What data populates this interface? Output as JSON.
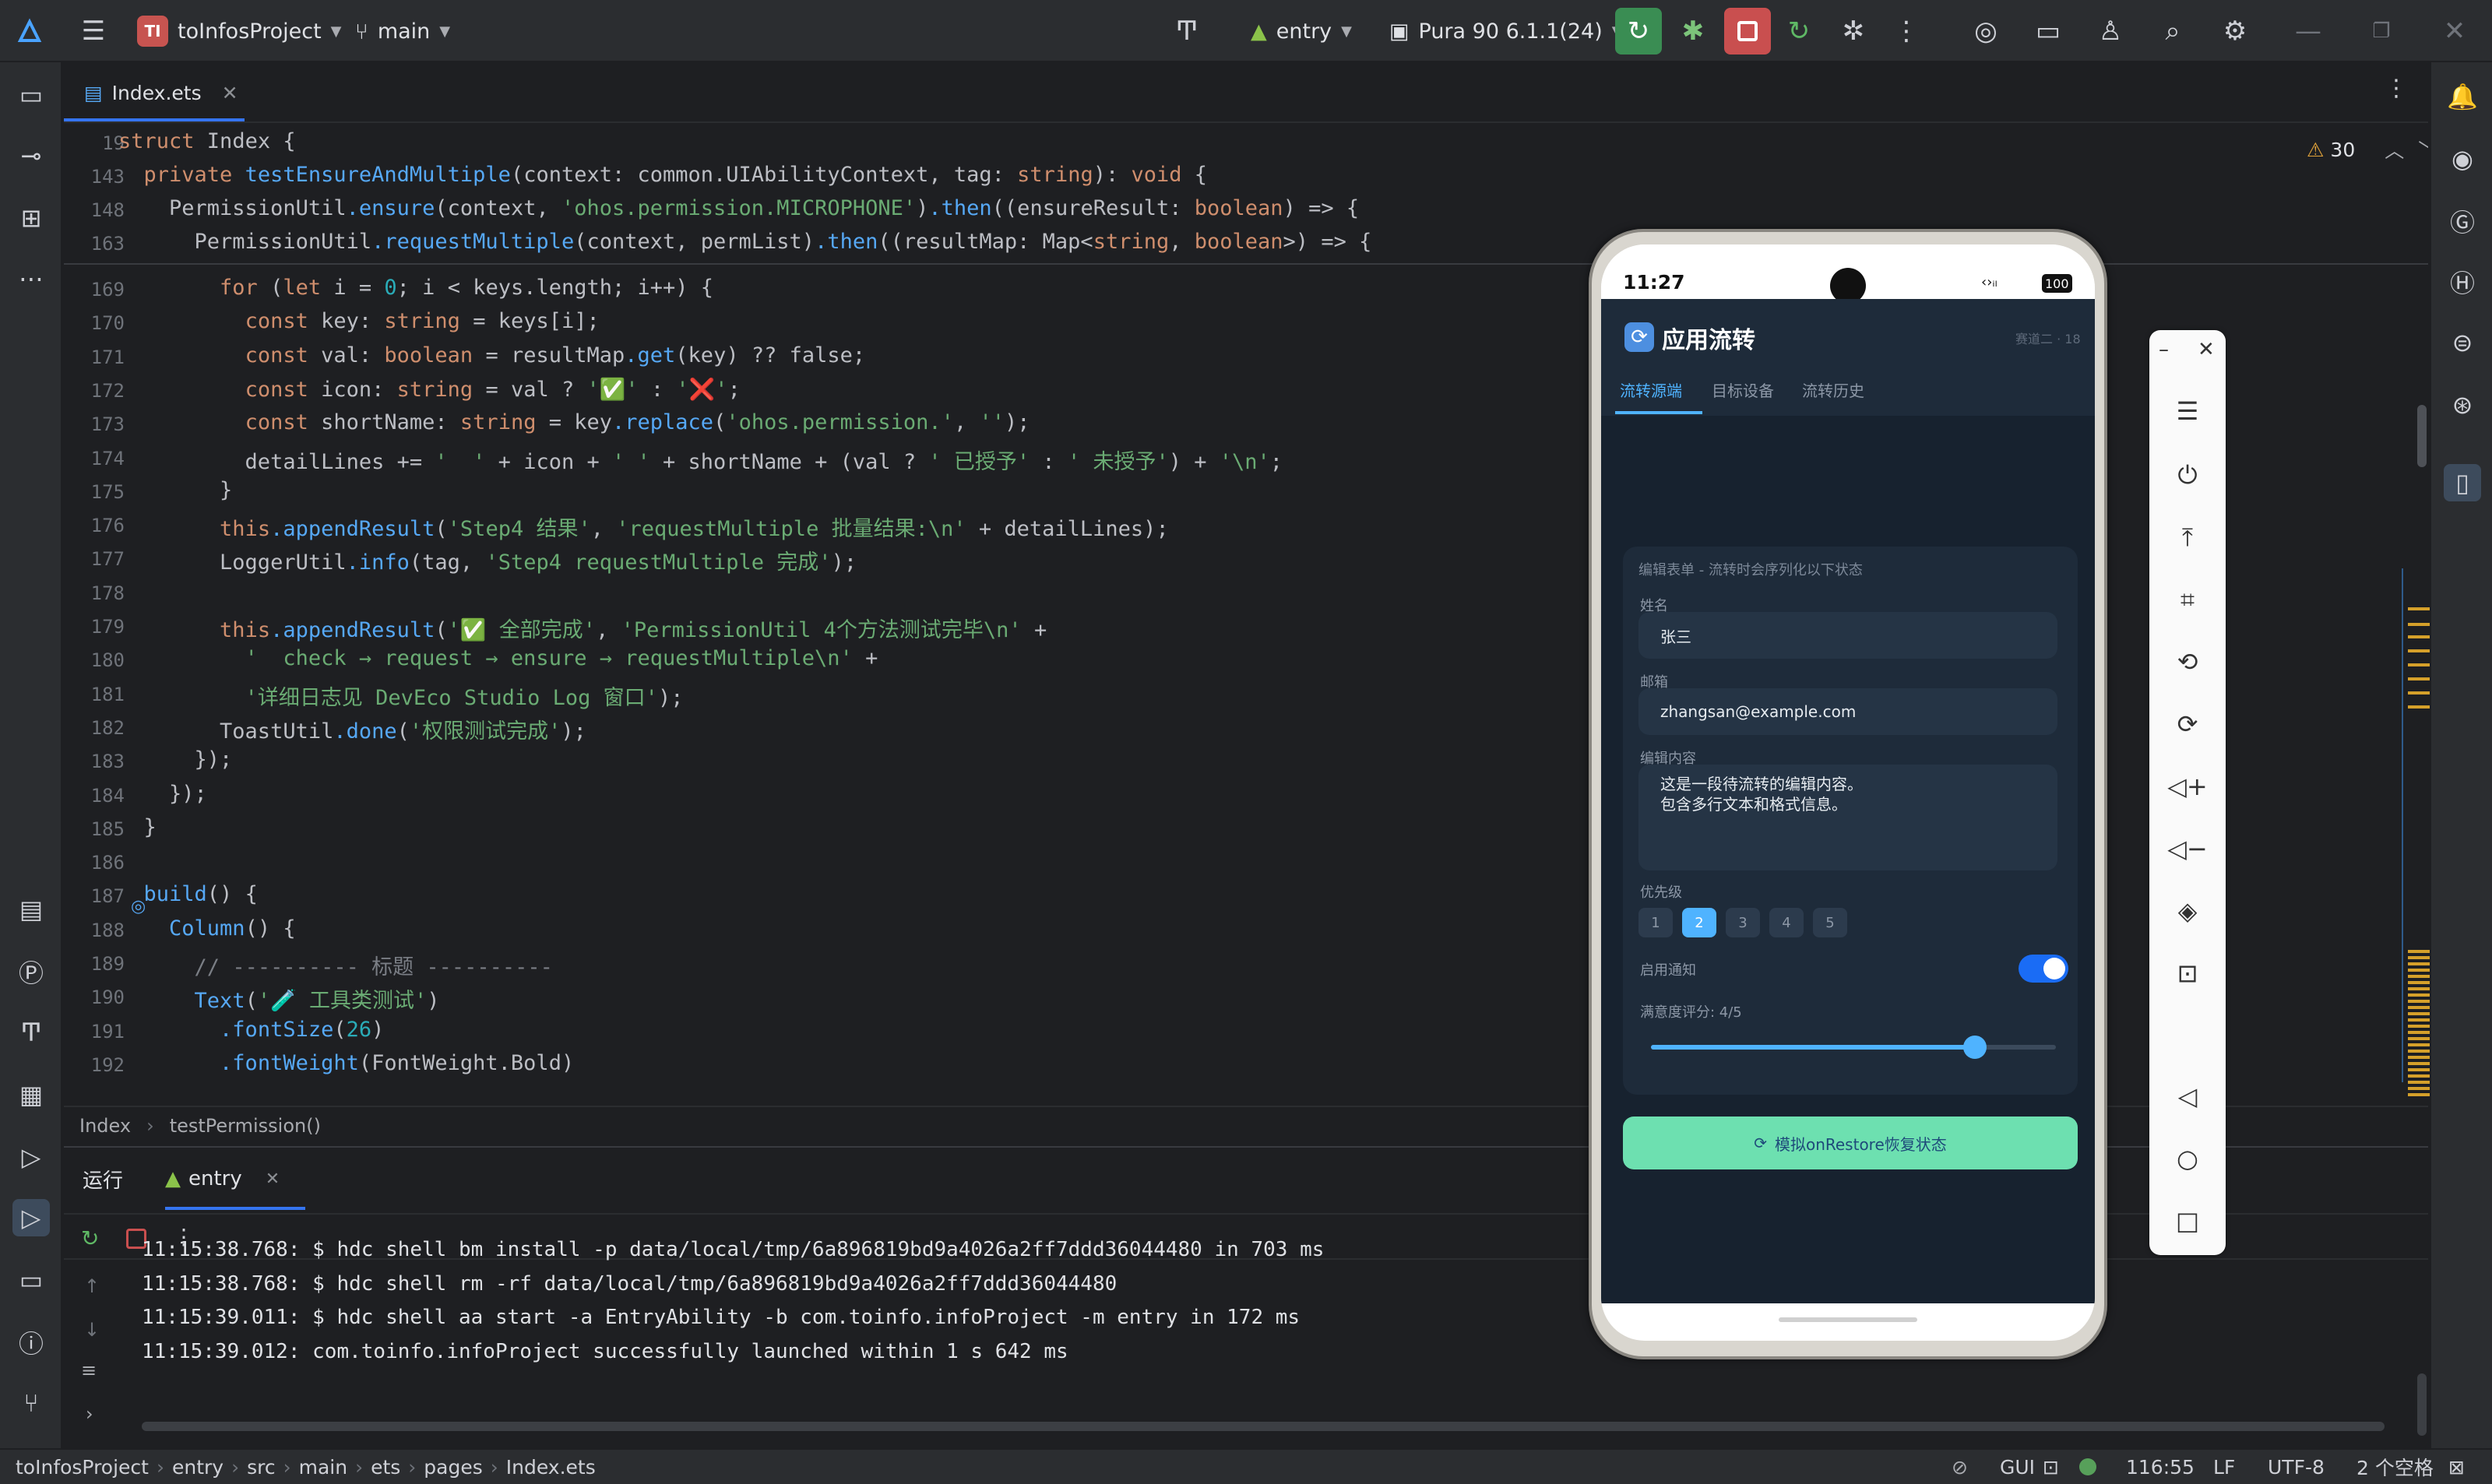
{
  "titlebar": {
    "project_badge": "TI",
    "project_name": "toInfosProject",
    "branch": "main",
    "run_config": "entry",
    "device": "Pura 90 6.1.1(24)"
  },
  "tabs": [
    {
      "label": "Index.ets"
    }
  ],
  "editor": {
    "warning_count": "30",
    "sticky_lines": [
      {
        "num": "19",
        "text": "struct Index {"
      },
      {
        "num": "143",
        "text": "  private testEnsureAndMultiple(context: common.UIAbilityContext, tag: string): void {"
      },
      {
        "num": "148",
        "text": "    PermissionUtil.ensure(context, 'ohos.permission.MICROPHONE').then((ensureResult: boolean) => {"
      },
      {
        "num": "163",
        "text": "      PermissionUtil.requestMultiple(context, permList).then((resultMap: Map<string, boolean>) => {"
      }
    ],
    "lines": [
      {
        "num": "169",
        "text": "        for (let i = 0; i < keys.length; i++) {"
      },
      {
        "num": "170",
        "text": "          const key: string = keys[i];"
      },
      {
        "num": "171",
        "text": "          const val: boolean = resultMap.get(key) ?? false;"
      },
      {
        "num": "172",
        "text": "          const icon: string = val ? '✅' : '❌';"
      },
      {
        "num": "173",
        "text": "          const shortName: string = key.replace('ohos.permission.', '');"
      },
      {
        "num": "174",
        "text": "          detailLines += '  ' + icon + ' ' + shortName + (val ? ' 已授予' : ' 未授予') + '\\n';"
      },
      {
        "num": "175",
        "text": "        }"
      },
      {
        "num": "176",
        "text": "        this.appendResult('Step4 结果', 'requestMultiple 批量结果:\\n' + detailLines);"
      },
      {
        "num": "177",
        "text": "        LoggerUtil.info(tag, 'Step4 requestMultiple 完成');"
      },
      {
        "num": "178",
        "text": ""
      },
      {
        "num": "179",
        "text": "        this.appendResult('✅ 全部完成', 'PermissionUtil 4个方法测试完毕\\n' +"
      },
      {
        "num": "180",
        "text": "          '  check → request → ensure → requestMultiple\\n' +"
      },
      {
        "num": "181",
        "text": "          '详细日志见 DevEco Studio Log 窗口');"
      },
      {
        "num": "182",
        "text": "        ToastUtil.done('权限测试完成');"
      },
      {
        "num": "183",
        "text": "      });"
      },
      {
        "num": "184",
        "text": "    });"
      },
      {
        "num": "185",
        "text": "  }"
      },
      {
        "num": "186",
        "text": ""
      },
      {
        "num": "187",
        "text": "  build() {"
      },
      {
        "num": "188",
        "text": "    Column() {"
      },
      {
        "num": "189",
        "text": "      // ---------- 标题 ----------"
      },
      {
        "num": "190",
        "text": "      Text('🧪 工具类测试')"
      },
      {
        "num": "191",
        "text": "        .fontSize(26)"
      },
      {
        "num": "192",
        "text": "        .fontWeight(FontWeight.Bold)"
      }
    ]
  },
  "breadcrumb": [
    "Index",
    "testPermission()"
  ],
  "run": {
    "tab_label": "运行",
    "config_tab": "entry",
    "log": [
      "11:15:38.768: $ hdc shell bm install -p data/local/tmp/6a896819bd9a4026a2ff7ddd36044480 in 703 ms",
      "11:15:38.768: $ hdc shell rm -rf data/local/tmp/6a896819bd9a4026a2ff7ddd36044480",
      "11:15:39.011: $ hdc shell aa start -a EntryAbility -b com.toinfo.infoProject -m entry in 172 ms",
      "11:15:39.012: com.toinfo.infoProject successfully launched within 1 s 642 ms"
    ]
  },
  "statusbar": {
    "path": [
      "toInfosProject",
      "entry",
      "src",
      "main",
      "ets",
      "pages",
      "Index.ets"
    ],
    "gui": "GUI",
    "position": "116:55",
    "line_sep": "LF",
    "encoding": "UTF-8",
    "indent": "2 个空格"
  },
  "phone": {
    "time": "11:27",
    "battery": "100",
    "app_title": "应用流转",
    "device_tag": "赛道二 · 18",
    "tabs": [
      "流转源端",
      "目标设备",
      "流转历史"
    ],
    "form_hint": "编辑表单 - 流转时会序列化以下状态",
    "name_label": "姓名",
    "name_value": "张三",
    "email_label": "邮箱",
    "email_value": "zhangsan@example.com",
    "content_label": "编辑内容",
    "content_line1": "这是一段待流转的编辑内容。",
    "content_line2": "包含多行文本和格式信息。",
    "priority_label": "优先级",
    "priorities": [
      "1",
      "2",
      "3",
      "4",
      "5"
    ],
    "priority_selected": 2,
    "notify_label": "启用通知",
    "notify_on": true,
    "rating_label": "满意度评分: 4/5",
    "rating_value": 0.8,
    "restore_button": "模拟onRestore恢复状态"
  },
  "colors": {
    "accent": "#56a8f5",
    "phone_bg": "#1e2b3a",
    "restore_button": "#6de0b0",
    "toggle": "#1a6cf5"
  }
}
